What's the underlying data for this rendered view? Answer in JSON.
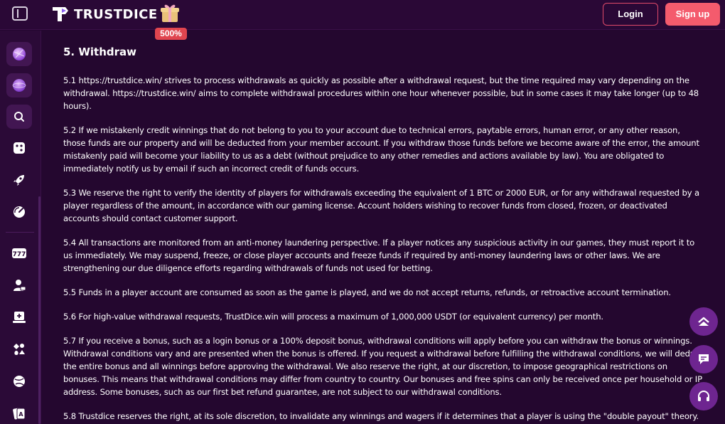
{
  "header": {
    "brand": "TRUSTDICE",
    "promo_badge": "500%",
    "login_label": "Login",
    "signup_label": "Sign up",
    "colors": {
      "accent": "#f45b6d",
      "background": "#24072f",
      "panel": "#2b0a37"
    }
  },
  "sidebar": {
    "items": [
      {
        "icon": "planet-gem-icon"
      },
      {
        "icon": "globe-gem-icon"
      },
      {
        "icon": "search-icon"
      },
      {
        "icon": "dice-icon"
      },
      {
        "icon": "rocket-icon"
      },
      {
        "icon": "gauge-icon"
      },
      {
        "icon": "slots-777-icon"
      },
      {
        "icon": "live-dealer-icon"
      },
      {
        "icon": "table-game-icon"
      },
      {
        "icon": "card-suits-icon"
      },
      {
        "icon": "sports-ball-icon"
      },
      {
        "icon": "poker-cards-icon"
      }
    ]
  },
  "main": {
    "title": "5. Withdraw",
    "paragraphs": [
      "5.1 https://trustdice.win/ strives to process withdrawals as quickly as possible after a withdrawal request, but the time required may vary depending on the withdrawal. https://trustdice.win/ aims to complete withdrawal procedures within one hour whenever possible, but in some cases it may take longer (up to 48 hours).",
      "5.2 If we mistakenly credit winnings that do not belong to you to your account due to technical errors, paytable errors, human error, or any other reason, those funds are our property and will be deducted from your member account. If you withdraw those funds before we become aware of the error, the amount mistakenly paid will become your liability to us as a debt (without prejudice to any other remedies and actions available by law). You are obligated to immediately notify us by email if such an incorrect credit of funds occurs.",
      "5.3 We reserve the right to verify the identity of players for withdrawals exceeding the equivalent of 1 BTC or 2000 EUR, or for any withdrawal requested by a player regardless of the amount, in accordance with our gaming license. Account holders wishing to recover funds from closed, frozen, or deactivated accounts should contact customer support.",
      "5.4 All transactions are monitored from an anti-money laundering perspective. If a player notices any suspicious activity in our games, they must report it to us immediately. We may suspend, freeze, or close player accounts and freeze funds if required by anti-money laundering laws or other laws. We are strengthening our due diligence efforts regarding withdrawals of funds not used for betting.",
      "5.5 Funds in a player account are consumed as soon as the game is played, and we do not accept returns, refunds, or retroactive account termination.",
      "5.6 For high-value withdrawal requests, TrustDice.win will process a maximum of 1,000,000 USDT (or equivalent currency) per month.",
      "5.7 If you receive a bonus, such as a login bonus or a 100% deposit bonus, withdrawal conditions will apply before you can withdraw the bonus or winnings. Withdrawal conditions vary and are presented when the bonus is offered. If you request a withdrawal before fulfilling the withdrawal conditions, we will deduct the entire bonus and all winnings before approving the withdrawal. We also reserve the right, at our discretion, to impose geographical restrictions on bonuses. This means that withdrawal conditions may differ from country to country. Our bonuses and free spins can only be received once per household or IP address. Some bonuses, such as our first bet refund guarantee, are not subject to our withdrawal conditions.",
      "5.8 Trustdice reserves the right, at its sole discretion, to invalidate any winnings and wagers if it determines that a player is using the \"double payout\" theory."
    ]
  },
  "floating": [
    {
      "icon": "scroll-top-icon"
    },
    {
      "icon": "chat-icon"
    },
    {
      "icon": "headset-icon"
    }
  ]
}
